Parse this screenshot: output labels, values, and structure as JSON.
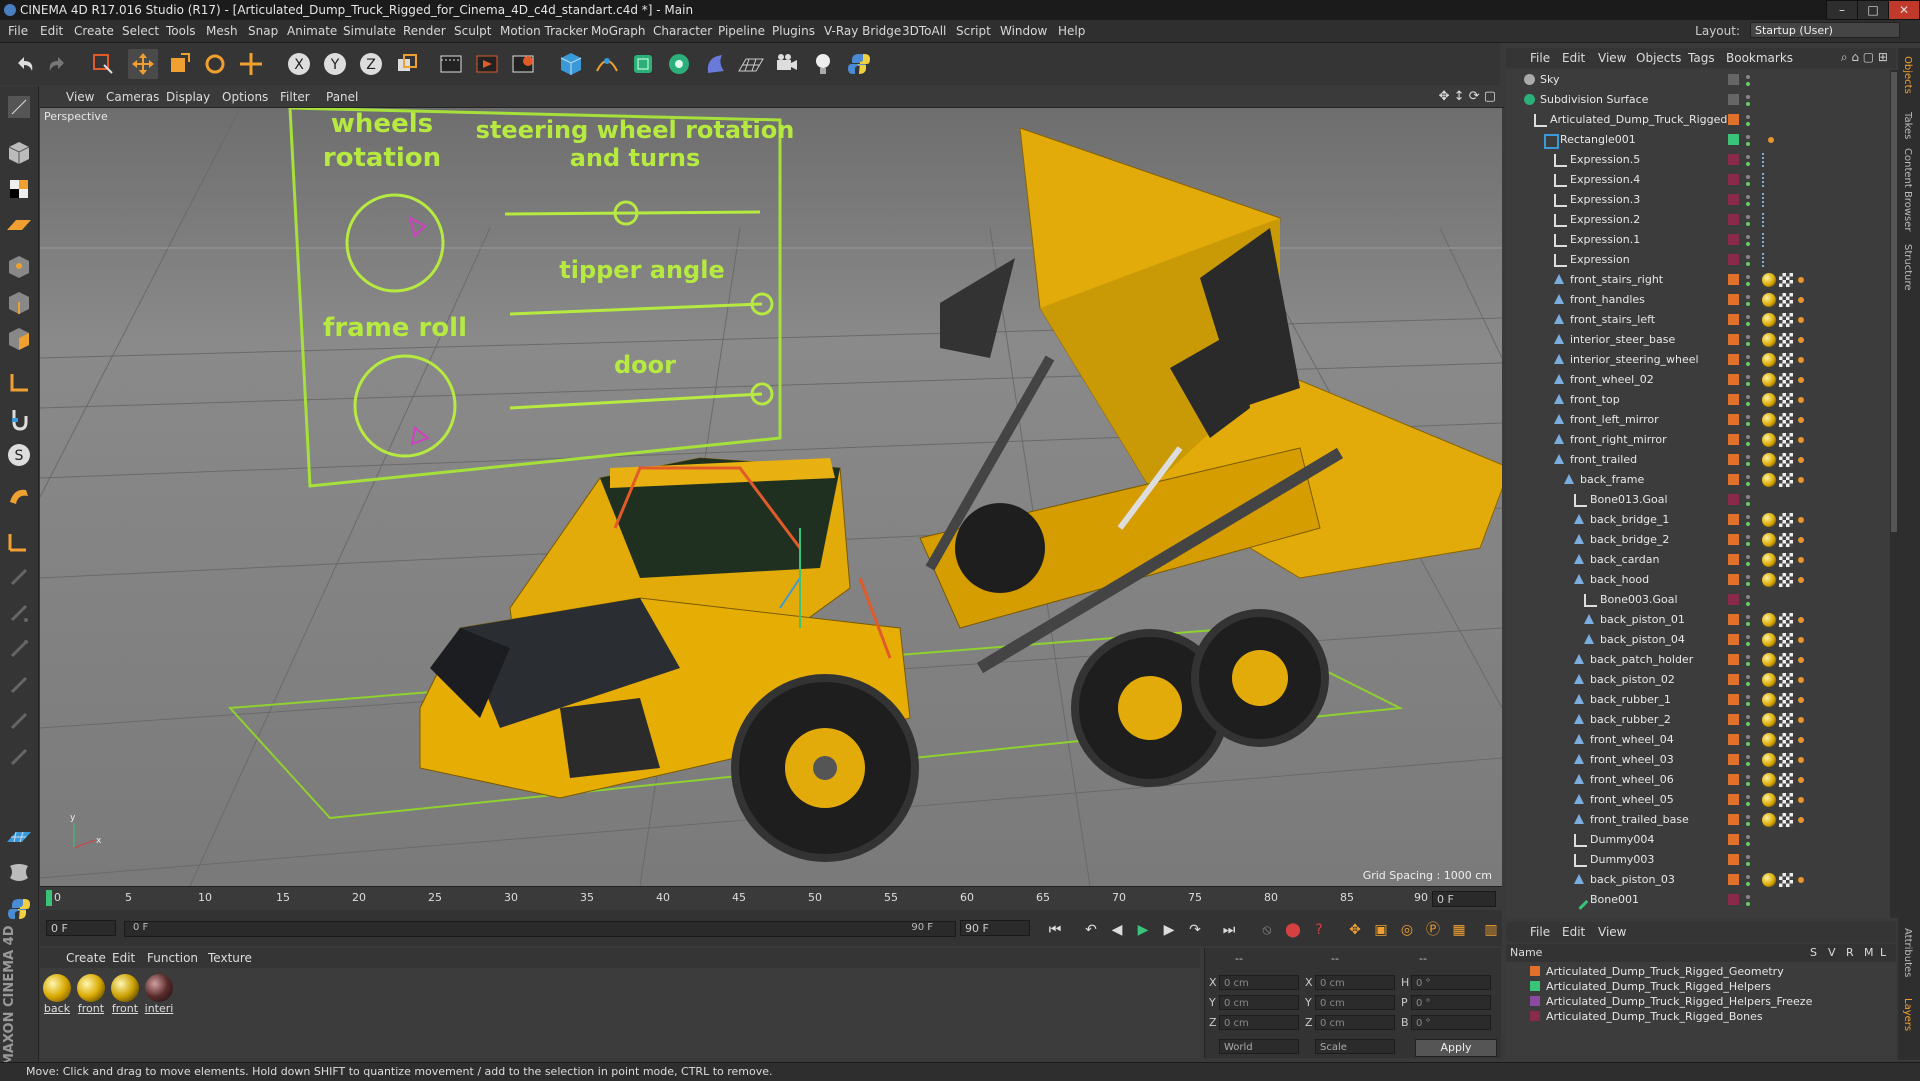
{
  "window": {
    "title": "CINEMA 4D R17.016 Studio (R17) - [Articulated_Dump_Truck_Rigged_for_Cinema_4D_c4d_standart.c4d *] - Main",
    "controls": [
      "–",
      "□",
      "✕"
    ]
  },
  "menu": [
    "File",
    "Edit",
    "Create",
    "Select",
    "Tools",
    "Mesh",
    "Snap",
    "Animate",
    "Simulate",
    "Render",
    "Sculpt",
    "Motion Tracker",
    "MoGraph",
    "Character",
    "Pipeline",
    "Plugins",
    "V-Ray Bridge",
    "3DToAll",
    "Script",
    "Window",
    "Help"
  ],
  "layout": {
    "label": "Layout:",
    "value": "Startup (User)"
  },
  "viewport": {
    "menu": [
      "View",
      "Cameras",
      "Display",
      "Options",
      "Filter",
      "Panel"
    ],
    "camera": "Perspective",
    "grid_spacing": "Grid Spacing : 1000 cm",
    "hud": {
      "wheels_rotation": "wheels rotation",
      "steering": "steering wheel rotation and turns",
      "tipper": "tipper angle",
      "frame_roll": "frame roll",
      "door": "door"
    }
  },
  "timeline": {
    "ticks": [
      "0",
      "5",
      "10",
      "15",
      "20",
      "25",
      "30",
      "35",
      "40",
      "45",
      "50",
      "55",
      "60",
      "65",
      "70",
      "75",
      "80",
      "85",
      "90"
    ],
    "end_frame": "0 F",
    "start_field": "0 F",
    "slider_left": "0 F",
    "slider_right": "90 F",
    "max_field": "90 F"
  },
  "material_manager": {
    "menu": [
      "Create",
      "Edit",
      "Function",
      "Texture"
    ],
    "materials": [
      {
        "name": "back",
        "color": "#d9a900"
      },
      {
        "name": "front",
        "color": "#d9a900"
      },
      {
        "name": "front",
        "color": "#caa000"
      },
      {
        "name": "interi",
        "color": "#5a2a2a"
      }
    ]
  },
  "coordinates": {
    "dashes": [
      "--",
      "--",
      "--"
    ],
    "rows": [
      {
        "axis": "X",
        "pos": "0 cm",
        "axis2": "X",
        "size": "0 cm",
        "rot_axis": "H",
        "rot": "0 °"
      },
      {
        "axis": "Y",
        "pos": "0 cm",
        "axis2": "Y",
        "size": "0 cm",
        "rot_axis": "P",
        "rot": "0 °"
      },
      {
        "axis": "Z",
        "pos": "0 cm",
        "axis2": "Z",
        "size": "0 cm",
        "rot_axis": "B",
        "rot": "0 °"
      }
    ],
    "mode": "World",
    "scale": "Scale",
    "apply": "Apply"
  },
  "status": "Move: Click and drag to move elements. Hold down SHIFT to quantize movement / add to the selection in point mode, CTRL to remove.",
  "object_manager": {
    "menu": [
      "File",
      "Edit",
      "View",
      "Objects",
      "Tags",
      "Bookmarks"
    ],
    "objects": [
      {
        "name": "Sky",
        "indent": 0,
        "kind": "sky",
        "layer": ""
      },
      {
        "name": "Subdivision Surface",
        "indent": 0,
        "kind": "subd",
        "layer": ""
      },
      {
        "name": "Articulated_Dump_Truck_Rigged",
        "indent": 1,
        "kind": "null",
        "layer": "#e0702a"
      },
      {
        "name": "Rectangle001",
        "indent": 2,
        "kind": "spline",
        "layer": "#3ac47a"
      },
      {
        "name": "Expression.5",
        "indent": 3,
        "kind": "null",
        "layer": "#8a2a4a"
      },
      {
        "name": "Expression.4",
        "indent": 3,
        "kind": "null",
        "layer": "#8a2a4a"
      },
      {
        "name": "Expression.3",
        "indent": 3,
        "kind": "null",
        "layer": "#8a2a4a"
      },
      {
        "name": "Expression.2",
        "indent": 3,
        "kind": "null",
        "layer": "#8a2a4a"
      },
      {
        "name": "Expression.1",
        "indent": 3,
        "kind": "null",
        "layer": "#8a2a4a"
      },
      {
        "name": "Expression",
        "indent": 3,
        "kind": "null",
        "layer": "#8a2a4a"
      },
      {
        "name": "front_stairs_right",
        "indent": 3,
        "kind": "bone",
        "layer": "#e0702a"
      },
      {
        "name": "front_handles",
        "indent": 3,
        "kind": "bone",
        "layer": "#e0702a"
      },
      {
        "name": "front_stairs_left",
        "indent": 3,
        "kind": "bone",
        "layer": "#e0702a"
      },
      {
        "name": "interior_steer_base",
        "indent": 3,
        "kind": "bone",
        "layer": "#e0702a"
      },
      {
        "name": "interior_steering_wheel",
        "indent": 3,
        "kind": "bone",
        "layer": "#e0702a"
      },
      {
        "name": "front_wheel_02",
        "indent": 3,
        "kind": "bone",
        "layer": "#e0702a"
      },
      {
        "name": "front_top",
        "indent": 3,
        "kind": "bone",
        "layer": "#e0702a"
      },
      {
        "name": "front_left_mirror",
        "indent": 3,
        "kind": "bone",
        "layer": "#e0702a"
      },
      {
        "name": "front_right_mirror",
        "indent": 3,
        "kind": "bone",
        "layer": "#e0702a"
      },
      {
        "name": "front_trailed",
        "indent": 3,
        "kind": "bone",
        "layer": "#e0702a"
      },
      {
        "name": "back_frame",
        "indent": 4,
        "kind": "bone",
        "layer": "#e0702a"
      },
      {
        "name": "Bone013.Goal",
        "indent": 5,
        "kind": "null",
        "layer": "#8a2a4a"
      },
      {
        "name": "back_bridge_1",
        "indent": 5,
        "kind": "bone",
        "layer": "#e0702a"
      },
      {
        "name": "back_bridge_2",
        "indent": 5,
        "kind": "bone",
        "layer": "#e0702a"
      },
      {
        "name": "back_cardan",
        "indent": 5,
        "kind": "bone",
        "layer": "#e0702a"
      },
      {
        "name": "back_hood",
        "indent": 5,
        "kind": "bone",
        "layer": "#e0702a"
      },
      {
        "name": "Bone003.Goal",
        "indent": 6,
        "kind": "null",
        "layer": "#8a2a4a"
      },
      {
        "name": "back_piston_01",
        "indent": 6,
        "kind": "bone",
        "layer": "#e0702a"
      },
      {
        "name": "back_piston_04",
        "indent": 6,
        "kind": "bone",
        "layer": "#e0702a"
      },
      {
        "name": "back_patch_holder",
        "indent": 5,
        "kind": "bone",
        "layer": "#e0702a"
      },
      {
        "name": "back_piston_02",
        "indent": 5,
        "kind": "bone",
        "layer": "#e0702a"
      },
      {
        "name": "back_rubber_1",
        "indent": 5,
        "kind": "bone",
        "layer": "#e0702a"
      },
      {
        "name": "back_rubber_2",
        "indent": 5,
        "kind": "bone",
        "layer": "#e0702a"
      },
      {
        "name": "front_wheel_04",
        "indent": 5,
        "kind": "bone",
        "layer": "#e0702a"
      },
      {
        "name": "front_wheel_03",
        "indent": 5,
        "kind": "bone",
        "layer": "#e0702a"
      },
      {
        "name": "front_wheel_06",
        "indent": 5,
        "kind": "bone",
        "layer": "#e0702a"
      },
      {
        "name": "front_wheel_05",
        "indent": 5,
        "kind": "bone",
        "layer": "#e0702a"
      },
      {
        "name": "front_trailed_base",
        "indent": 5,
        "kind": "bone",
        "layer": "#e0702a"
      },
      {
        "name": "Dummy004",
        "indent": 5,
        "kind": "null",
        "layer": "#e0702a"
      },
      {
        "name": "Dummy003",
        "indent": 5,
        "kind": "null",
        "layer": "#e0702a"
      },
      {
        "name": "back_piston_03",
        "indent": 5,
        "kind": "bone",
        "layer": "#e0702a"
      },
      {
        "name": "Bone001",
        "indent": 5,
        "kind": "bone2",
        "layer": "#8a2a4a"
      }
    ]
  },
  "layer_manager": {
    "menu": [
      "File",
      "Edit",
      "View"
    ],
    "header": {
      "name": "Name",
      "cols": [
        "S",
        "V",
        "R",
        "M",
        "L"
      ]
    },
    "layers": [
      {
        "name": "Articulated_Dump_Truck_Rigged_Geometry",
        "color": "#e0702a"
      },
      {
        "name": "Articulated_Dump_Truck_Rigged_Helpers",
        "color": "#3ac47a"
      },
      {
        "name": "Articulated_Dump_Truck_Rigged_Helpers_Freeze",
        "color": "#8a4aa0"
      },
      {
        "name": "Articulated_Dump_Truck_Rigged_Bones",
        "color": "#8a2a4a"
      }
    ]
  },
  "side_tabs": [
    "Objects",
    "Takes",
    "Content Browser",
    "Structure",
    "Attributes",
    "Layers"
  ],
  "brand": "MAXON CINEMA 4D"
}
